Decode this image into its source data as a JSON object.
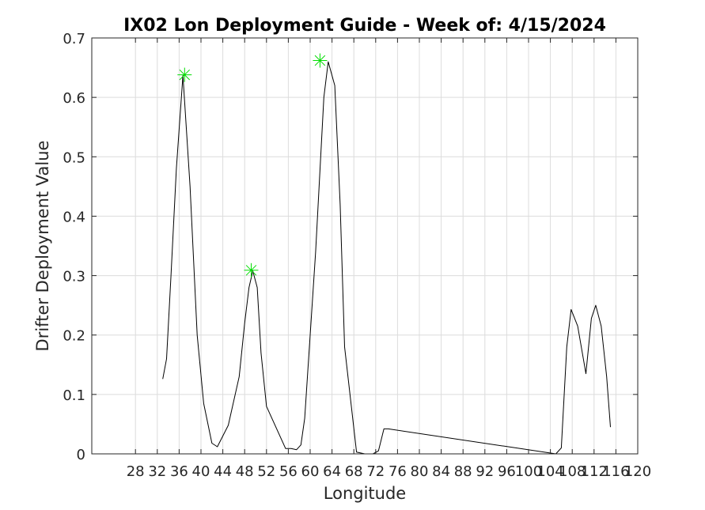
{
  "chart_data": {
    "type": "line",
    "title": "IX02 Lon Deployment Guide - Week of: 4/15/2024",
    "xlabel": "Longitude",
    "ylabel": "Drifter Deployment Value",
    "xlim": [
      20,
      120
    ],
    "ylim": [
      0,
      0.7
    ],
    "xticks": [
      28,
      32,
      36,
      40,
      44,
      48,
      52,
      56,
      60,
      64,
      68,
      72,
      76,
      80,
      84,
      88,
      92,
      96,
      100,
      104,
      108,
      112,
      116,
      120
    ],
    "yticks": [
      0,
      0.1,
      0.2,
      0.3,
      0.4,
      0.5,
      0.6,
      0.7
    ],
    "grid": true,
    "series": [
      {
        "color": "#000000",
        "x": [
          33,
          33.7,
          34.5,
          35.5,
          36.7,
          38,
          39.3,
          40.5,
          42,
          43,
          45,
          47,
          48,
          48.8,
          49.5,
          50.3,
          51,
          52,
          55.5,
          56.5,
          57.5,
          58.3,
          59,
          61,
          62.5,
          63.3,
          64.5,
          65.5,
          66.3,
          68.5,
          70,
          71.5,
          72.5,
          73.5,
          74.3,
          105,
          106,
          107,
          107.8,
          109,
          110.5,
          111.5,
          112.3,
          113.3,
          114.3,
          115
        ],
        "y": [
          0.126,
          0.16,
          0.3,
          0.48,
          0.637,
          0.45,
          0.2,
          0.085,
          0.018,
          0.012,
          0.048,
          0.13,
          0.22,
          0.28,
          0.308,
          0.28,
          0.17,
          0.08,
          0.009,
          0.009,
          0.007,
          0.015,
          0.06,
          0.34,
          0.6,
          0.66,
          0.62,
          0.42,
          0.18,
          0.003,
          0,
          0,
          0.005,
          0.042,
          0.042,
          0,
          0.01,
          0.18,
          0.243,
          0.215,
          0.135,
          0.228,
          0.25,
          0.215,
          0.13,
          0.045
        ]
      }
    ],
    "peaks": {
      "color": "#00dd00",
      "x": [
        37,
        49.2,
        61.8
      ],
      "y": [
        0.638,
        0.309,
        0.662
      ]
    }
  }
}
